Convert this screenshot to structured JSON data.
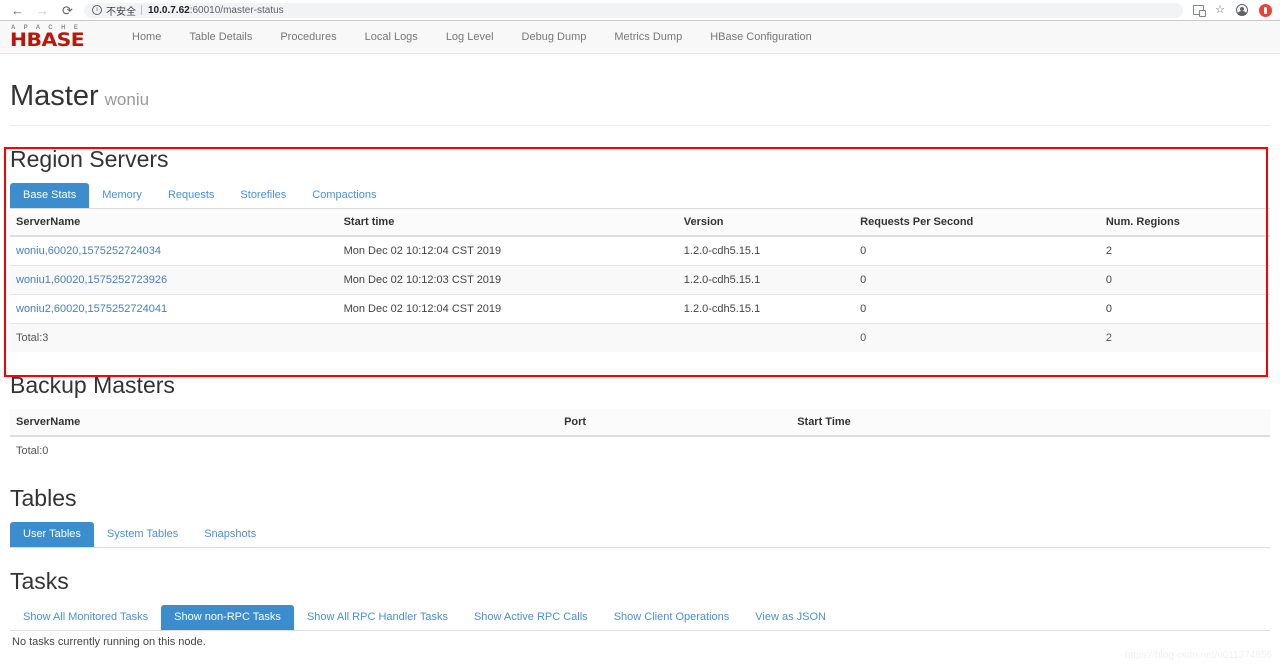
{
  "browser": {
    "back_icon": "←",
    "forward_icon": "→",
    "reload_icon": "⟳",
    "security_label": "不安全",
    "url_host": "10.0.7.62",
    "url_rest": ":60010/master-status",
    "translate_icon": "translate-icon",
    "bookmark_icon": "☆",
    "profile_icon": "profile-avatar-icon",
    "extension_icon": "red-extension-icon"
  },
  "navbar": {
    "brand_top": "A P A C H E",
    "brand_main": "HBASE",
    "links": [
      "Home",
      "Table Details",
      "Procedures",
      "Local Logs",
      "Log Level",
      "Debug Dump",
      "Metrics Dump",
      "HBase Configuration"
    ]
  },
  "page": {
    "title": "Master",
    "subtitle": "woniu"
  },
  "region_servers": {
    "heading": "Region Servers",
    "tabs": [
      {
        "label": "Base Stats",
        "active": true
      },
      {
        "label": "Memory",
        "active": false
      },
      {
        "label": "Requests",
        "active": false
      },
      {
        "label": "Storefiles",
        "active": false
      },
      {
        "label": "Compactions",
        "active": false
      }
    ],
    "columns": [
      "ServerName",
      "Start time",
      "Version",
      "Requests Per Second",
      "Num. Regions"
    ],
    "rows": [
      {
        "server_name": "woniu,60020,1575252724034",
        "start_time": "Mon Dec 02 10:12:04 CST 2019",
        "version": "1.2.0-cdh5.15.1",
        "requests_per_second": "0",
        "num_regions": "2"
      },
      {
        "server_name": "woniu1,60020,1575252723926",
        "start_time": "Mon Dec 02 10:12:03 CST 2019",
        "version": "1.2.0-cdh5.15.1",
        "requests_per_second": "0",
        "num_regions": "0"
      },
      {
        "server_name": "woniu2,60020,1575252724041",
        "start_time": "Mon Dec 02 10:12:04 CST 2019",
        "version": "1.2.0-cdh5.15.1",
        "requests_per_second": "0",
        "num_regions": "0"
      }
    ],
    "total": {
      "label": "Total:3",
      "start_time": "",
      "version": "",
      "requests_per_second": "0",
      "num_regions": "2"
    }
  },
  "backup_masters": {
    "heading": "Backup Masters",
    "columns": [
      "ServerName",
      "Port",
      "Start Time"
    ],
    "total": {
      "label": "Total:0",
      "port": "",
      "start_time": ""
    }
  },
  "tables_section": {
    "heading": "Tables",
    "tabs": [
      {
        "label": "User Tables",
        "active": true
      },
      {
        "label": "System Tables",
        "active": false
      },
      {
        "label": "Snapshots",
        "active": false
      }
    ]
  },
  "tasks": {
    "heading": "Tasks",
    "tabs": [
      {
        "label": "Show All Monitored Tasks",
        "active": false
      },
      {
        "label": "Show non-RPC Tasks",
        "active": true
      },
      {
        "label": "Show All RPC Handler Tasks",
        "active": false
      },
      {
        "label": "Show Active RPC Calls",
        "active": false
      },
      {
        "label": "Show Client Operations",
        "active": false
      },
      {
        "label": "View as JSON",
        "active": false
      }
    ],
    "note": "No tasks currently running on this node."
  },
  "watermark": "https://blog.csdn.net/u011374856",
  "colors": {
    "brand_red": "#ba160c",
    "link_blue": "#4a90d9",
    "active_tab_blue": "#3c8dce",
    "highlight_red": "#ff0000"
  }
}
